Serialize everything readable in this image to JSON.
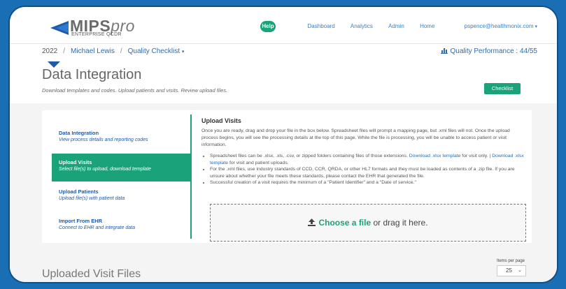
{
  "brand": {
    "logo_main": "MIPS",
    "logo_pro": "pro",
    "logo_sub": "ENTERPRISE QCDR"
  },
  "nav": {
    "help": "Help",
    "links": [
      "Dashboard",
      "Analytics",
      "Admin",
      "Home",
      "pspence@healthmonix.com"
    ]
  },
  "breadcrumb": {
    "year": "2022",
    "person": "Michael Lewis",
    "section": "Quality Checklist"
  },
  "performance": {
    "label": "Quality Performance : 44/55"
  },
  "page": {
    "title": "Data Integration",
    "subtitle": "Download templates and codes. Upload patients and visits. Review upload files.",
    "checklist_button": "Checklist"
  },
  "sidebar": {
    "items": [
      {
        "title": "Data Integration",
        "desc": "View process details and reporting codes",
        "active": false
      },
      {
        "title": "Upload Visits",
        "desc": "Select file(s) to upload, download template",
        "active": true
      },
      {
        "title": "Upload Patients",
        "desc": "Upload file(s) with patient data",
        "active": false
      },
      {
        "title": "Import From EHR",
        "desc": "Connect to EHR and integrate data",
        "active": false
      }
    ]
  },
  "upload_visits": {
    "heading": "Upload Visits",
    "intro": "Once you are ready, drag and drop your file in the box below. Spreadsheet files will prompt a mapping page, but .xml files will not. Once the upload process begins, you will see the processing details at the top of this page. While the file is processing, you will be unable to access patient or visit information.",
    "b1_a": "Spreadsheet files can be .xlsx, .xls, .csv, or zipped folders containing files of those extensions. ",
    "b1_link1": "Download .xlsx template",
    "b1_b": " for visit only. | ",
    "b1_link2": "Download .xlsx template",
    "b1_c": " for visit and patient uploads.",
    "b2": "For the .xml files, use industry standards of CCD, CCR, QRDA, or other HL7 formats and they must be loaded as contents of a .zip file. If you are unsure about whether your file meets these standards, please contact the EHR that generated the file.",
    "b3": "Successful creation of a visit requires the minimum of a \"Patient Identifier\" and a \"Date of service.\""
  },
  "dropzone": {
    "choose": "Choose a file",
    "rest": " or drag it here."
  },
  "files": {
    "title": "Uploaded Visit Files",
    "items_per_page_label": "Items per page",
    "items_per_page_value": "25"
  },
  "colors": {
    "accent_green": "#1aa37a",
    "link_blue": "#2b6cb0",
    "frame_blue": "#1a6fb4"
  }
}
